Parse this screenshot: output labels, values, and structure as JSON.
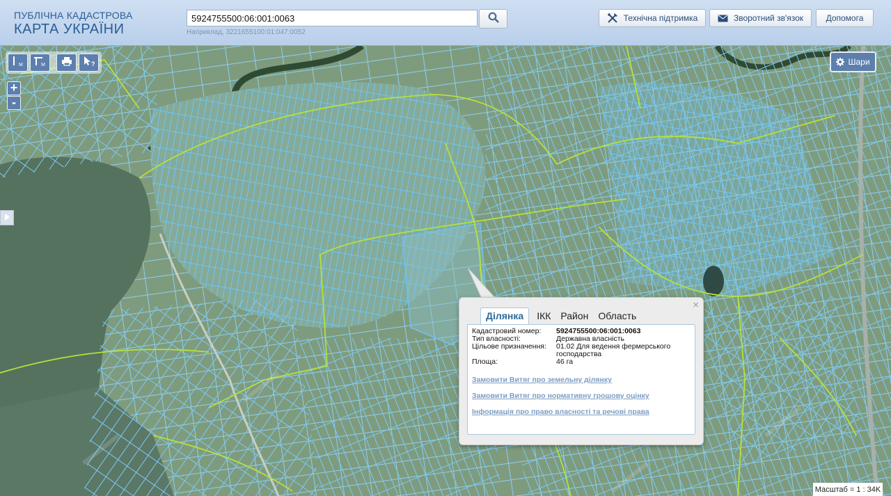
{
  "header": {
    "brand_line1": "ПУБЛІЧНА КАДАСТРОВА",
    "brand_line2": "КАРТА УКРАЇНИ",
    "search_value": "5924755500:06:001:0063",
    "search_hint": "Наприклад, 3221655100:01:047:0052",
    "buttons": {
      "support": "Технічна підтримка",
      "feedback": "Зворотний зв'язок",
      "help": "Допомога"
    }
  },
  "map": {
    "tools": [
      "ruler-icon",
      "area-ruler-icon",
      "print-icon",
      "identify-icon"
    ],
    "tool_labels": {
      "ruler_sub": "M",
      "area_sub": "M",
      "identify_sub": "?"
    },
    "zoom_in": "+",
    "zoom_out": "-",
    "layers_label": "Шари",
    "scale_label": "Масштаб = 1 : 34K"
  },
  "popup": {
    "tabs": [
      "Ділянка",
      "ІКК",
      "Район",
      "Область"
    ],
    "active_tab": 0,
    "fields": [
      {
        "label": "Кадастровий номер:",
        "value": "5924755500:06:001:0063"
      },
      {
        "label": "Тип власності:",
        "value": "Державна власність"
      },
      {
        "label": "Цільове призначення:",
        "value": "01.02 Для ведення фермерського господарства"
      },
      {
        "label": "Площа:",
        "value": "46 га"
      }
    ],
    "links": [
      "Замовити Витяг про земельну ділянку",
      "Замовити Витяг про нормативну грошову оцінку",
      "Інформація про право власності та речові права"
    ],
    "close": "×"
  },
  "colors": {
    "header_top": "#cfdff2",
    "brand": "#2a5d96",
    "parcel_blue": "#6cc3f2",
    "boundary_green": "#b5e23a",
    "control_blue": "#5d7fae",
    "link": "#7c9dc4"
  }
}
